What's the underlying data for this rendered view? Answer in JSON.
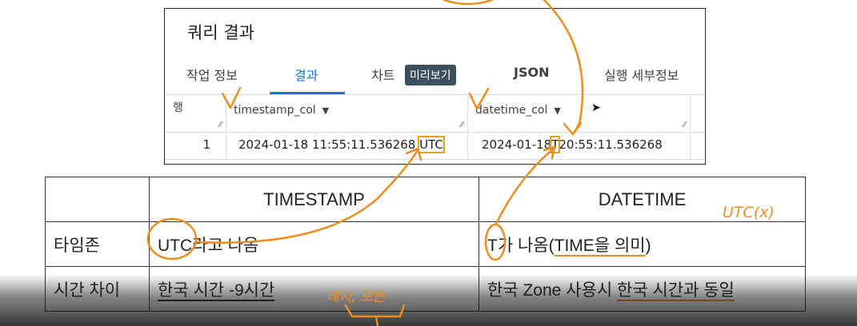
{
  "panel": {
    "title": "쿼리 결과",
    "tabs": [
      {
        "label": "작업 정보"
      },
      {
        "label": "결과",
        "active": true
      },
      {
        "label": "차트"
      },
      {
        "label": "JSON"
      },
      {
        "label": "실행 세부정보"
      }
    ],
    "badge": "미리보기",
    "grid": {
      "row_header": "행",
      "columns": [
        "timestamp_col",
        "datetime_col"
      ],
      "rows": [
        {
          "num": "1",
          "timestamp_main": "2024-01-18 11:55:11.536268 ",
          "timestamp_tz": "UTC",
          "datetime_a": "2024-01-18",
          "datetime_t": "T",
          "datetime_b": "20:55:11.536268"
        }
      ]
    }
  },
  "comparison": {
    "headers": [
      "",
      "TIMESTAMP",
      "DATETIME"
    ],
    "rows": [
      {
        "label": "타임존",
        "ts": "UTC라고 나옴",
        "dt_a": "T가 나옴(",
        "dt_b": "TIME을 의미",
        "dt_c": ")"
      },
      {
        "label": "시간 차이",
        "ts": "한국 시간 -9시간",
        "dt_a": "한국 Zone 사용시 ",
        "dt_b": "한국 시간과 동일"
      }
    ]
  },
  "annotations": {
    "note_a": "UTC(x)",
    "note_b": "예시, 모든"
  },
  "colors": {
    "accent": "#1a73e8",
    "annotation_orange": "#f08c1b",
    "badge_bg": "#3c4f5e"
  }
}
